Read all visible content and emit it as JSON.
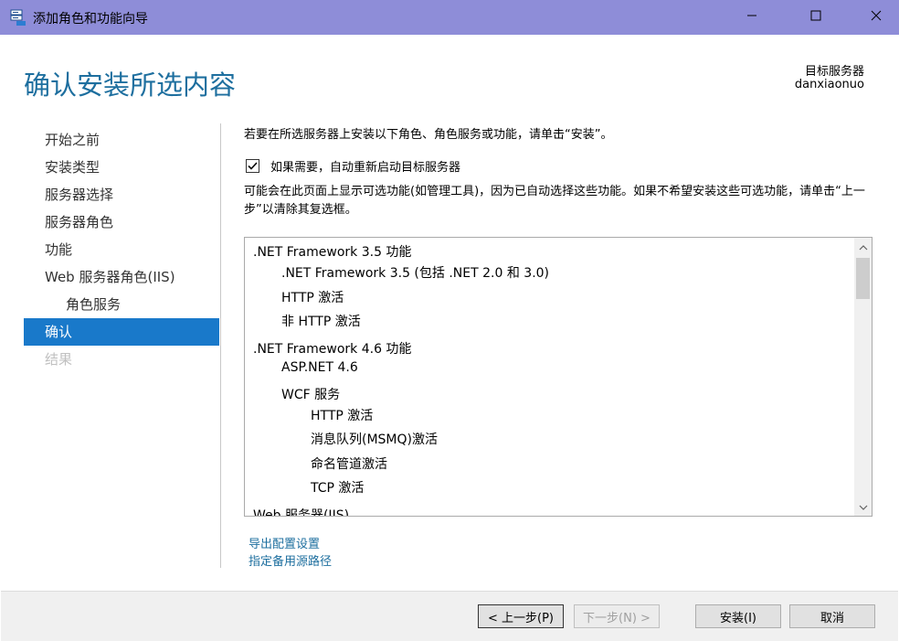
{
  "window": {
    "title": "添加角色和功能向导",
    "controls": {
      "minimize": "minimize-icon",
      "maximize": "maximize-icon",
      "close": "close-icon"
    }
  },
  "header": {
    "page_title": "确认安装所选内容",
    "target_label": "目标服务器",
    "target_value": "danxiaonuo"
  },
  "nav": {
    "items": [
      {
        "label": "开始之前",
        "state": "normal"
      },
      {
        "label": "安装类型",
        "state": "normal"
      },
      {
        "label": "服务器选择",
        "state": "normal"
      },
      {
        "label": "服务器角色",
        "state": "normal"
      },
      {
        "label": "功能",
        "state": "normal"
      },
      {
        "label": "Web 服务器角色(IIS)",
        "state": "normal"
      },
      {
        "label": "角色服务",
        "state": "sub"
      },
      {
        "label": "确认",
        "state": "active"
      },
      {
        "label": "结果",
        "state": "disabled"
      }
    ]
  },
  "main": {
    "intro": "若要在所选服务器上安装以下角色、角色服务或功能，请单击“安装”。",
    "restart_checkbox": {
      "label": "如果需要，自动重新启动目标服务器",
      "checked": true
    },
    "note": "可能会在此页面上显示可选功能(如管理工具)，因为已自动选择这些功能。如果不希望安装这些可选功能，请单击“上一步”以清除其复选框。",
    "features": [
      {
        "label": ".NET Framework 3.5 功能",
        "level": 0
      },
      {
        "label": ".NET Framework 3.5 (包括 .NET 2.0 和 3.0)",
        "level": 1
      },
      {
        "label": "HTTP 激活",
        "level": 1
      },
      {
        "label": "非 HTTP 激活",
        "level": 1
      },
      {
        "label": ".NET Framework 4.6 功能",
        "level": 0
      },
      {
        "label": "ASP.NET 4.6",
        "level": 1
      },
      {
        "label": "WCF 服务",
        "level": 1
      },
      {
        "label": "HTTP 激活",
        "level": 2
      },
      {
        "label": "消息队列(MSMQ)激活",
        "level": 2
      },
      {
        "label": "命名管道激活",
        "level": 2
      },
      {
        "label": "TCP 激活",
        "level": 2
      },
      {
        "label": "Web 服务器(IIS)",
        "level": 0
      }
    ],
    "links": {
      "export": "导出配置设置",
      "alt_source": "指定备用源路径"
    }
  },
  "footer": {
    "prev": "< 上一步(P)",
    "next": "下一步(N) >",
    "install": "安装(I)",
    "cancel": "取消"
  },
  "colors": {
    "titlebar": "#8e8dd8",
    "accent": "#1e6f9f",
    "nav_active": "#1979ca"
  }
}
